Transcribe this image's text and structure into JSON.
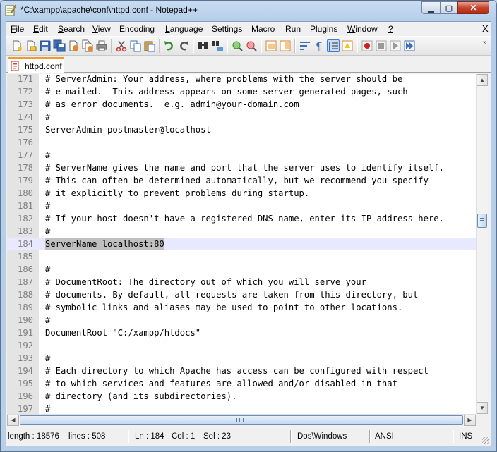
{
  "window": {
    "title": "*C:\\xampp\\apache\\conf\\httpd.conf - Notepad++"
  },
  "menubar": {
    "items": [
      {
        "label": "F",
        "rest": "ile"
      },
      {
        "label": "E",
        "rest": "dit"
      },
      {
        "label": "S",
        "rest": "earch"
      },
      {
        "label": "V",
        "rest": "iew"
      },
      {
        "label": "",
        "rest": "Encoding"
      },
      {
        "label": "L",
        "rest": "anguage"
      },
      {
        "label": "",
        "rest": "Settings"
      },
      {
        "label": "",
        "rest": "Macro"
      },
      {
        "label": "",
        "rest": "Run"
      },
      {
        "label": "",
        "rest": "Plugins"
      },
      {
        "label": "W",
        "rest": "indow"
      },
      {
        "label": "?",
        "rest": ""
      }
    ],
    "close": "X"
  },
  "toolbar": {
    "icons": [
      "new-file-icon",
      "open-file-icon",
      "save-icon",
      "save-all-icon",
      "close-icon",
      "close-all-icon",
      "print-icon",
      "cut-icon",
      "copy-icon",
      "paste-icon",
      "undo-icon",
      "redo-icon",
      "find-icon",
      "replace-icon",
      "zoom-in-icon",
      "zoom-out-icon",
      "sync-vertical-icon",
      "sync-horizontal-icon",
      "word-wrap-icon",
      "show-all-characters-icon",
      "indent-guide-icon",
      "user-language-icon",
      "record-macro-icon",
      "stop-recording-icon",
      "play-macro-icon",
      "run-macro-multiple-icon"
    ],
    "overflow": "»"
  },
  "tabs": [
    {
      "label": "httpd.conf",
      "modified": true
    }
  ],
  "editor": {
    "current_line": 184,
    "lines": [
      {
        "n": "171",
        "text": "# ServerAdmin: Your address, where problems with the server should be"
      },
      {
        "n": "172",
        "text": "# e-mailed.  This address appears on some server-generated pages, such"
      },
      {
        "n": "173",
        "text": "# as error documents.  e.g. admin@your-domain.com"
      },
      {
        "n": "174",
        "text": "#"
      },
      {
        "n": "175",
        "text": "ServerAdmin postmaster@localhost"
      },
      {
        "n": "176",
        "text": ""
      },
      {
        "n": "177",
        "text": "#"
      },
      {
        "n": "178",
        "text": "# ServerName gives the name and port that the server uses to identify itself."
      },
      {
        "n": "179",
        "text": "# This can often be determined automatically, but we recommend you specify"
      },
      {
        "n": "180",
        "text": "# it explicitly to prevent problems during startup."
      },
      {
        "n": "181",
        "text": "#"
      },
      {
        "n": "182",
        "text": "# If your host doesn't have a registered DNS name, enter its IP address here."
      },
      {
        "n": "183",
        "text": "#"
      },
      {
        "n": "184",
        "text": "ServerName localhost:80"
      },
      {
        "n": "185",
        "text": ""
      },
      {
        "n": "186",
        "text": "#"
      },
      {
        "n": "187",
        "text": "# DocumentRoot: The directory out of which you will serve your"
      },
      {
        "n": "188",
        "text": "# documents. By default, all requests are taken from this directory, but"
      },
      {
        "n": "189",
        "text": "# symbolic links and aliases may be used to point to other locations."
      },
      {
        "n": "190",
        "text": "#"
      },
      {
        "n": "191",
        "text": "DocumentRoot \"C:/xampp/htdocs\""
      },
      {
        "n": "192",
        "text": ""
      },
      {
        "n": "193",
        "text": "#"
      },
      {
        "n": "194",
        "text": "# Each directory to which Apache has access can be configured with respect"
      },
      {
        "n": "195",
        "text": "# to which services and features are allowed and/or disabled in that"
      },
      {
        "n": "196",
        "text": "# directory (and its subdirectories)."
      },
      {
        "n": "197",
        "text": "#"
      }
    ]
  },
  "statusbar": {
    "length": "length : 18576",
    "lines": "lines : 508",
    "ln": "Ln : 184",
    "col": "Col : 1",
    "sel": "Sel : 23",
    "eol": "Dos\\Windows",
    "encoding": "ANSI",
    "mode": "INS"
  }
}
